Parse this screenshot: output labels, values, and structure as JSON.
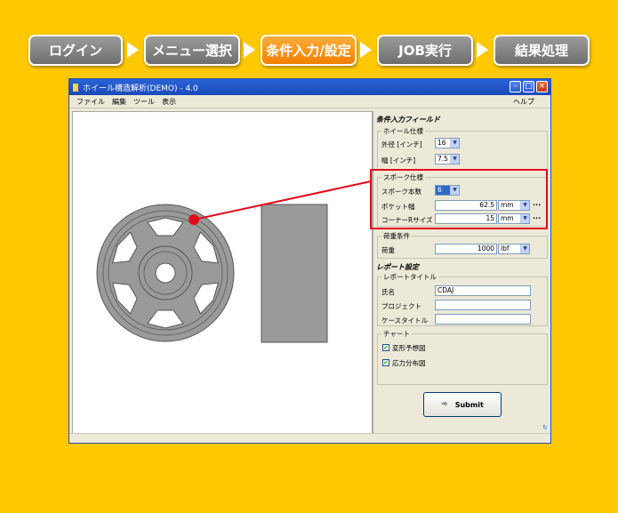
{
  "steps": [
    {
      "label": "ログイン",
      "active": false
    },
    {
      "label": "メニュー選択",
      "active": false
    },
    {
      "label": "条件入力/設定",
      "active": true
    },
    {
      "label": "JOB実行",
      "active": false
    },
    {
      "label": "結果処理",
      "active": false
    }
  ],
  "window": {
    "title": "ホイール構造解析(DEMO) - 4.0",
    "menu": [
      "ファイル",
      "編集",
      "ツール",
      "表示"
    ],
    "help": "ヘルプ"
  },
  "panel": {
    "header": "条件入力フィールド",
    "wheel_spec": {
      "title": "ホイール仕様",
      "diameter_label": "外径 [インチ]",
      "diameter_value": "16",
      "width_label": "幅 [インチ]",
      "width_value": "7.5"
    },
    "spoke_spec": {
      "title": "スポーク仕様",
      "count_label": "スポーク本数",
      "count_value": "6",
      "pocket_label": "ポケット幅",
      "pocket_value": "62.5",
      "pocket_unit": "mm",
      "corner_label": "コーナーRサイズ",
      "corner_value": "15",
      "corner_unit": "mm",
      "more": "..."
    },
    "load": {
      "title": "荷重条件",
      "label": "荷重",
      "value": "1000",
      "unit": "lbf"
    },
    "report": {
      "header": "レポート設定",
      "title_group": "レポートタイトル",
      "name_label": "氏名",
      "name_value": "CDAJ",
      "project_label": "プロジェクト",
      "project_value": "",
      "case_label": "ケースタイトル",
      "case_value": "",
      "chart_group": "チャート",
      "chart_options": [
        {
          "label": "変形予想図",
          "checked": true
        },
        {
          "label": "応力分布図",
          "checked": true
        }
      ]
    },
    "submit_label": "Submit"
  },
  "colors": {
    "background": "#FFC800",
    "active_step": "#F28A10",
    "inactive_step": "#8A8A8A",
    "highlight": "#E3081B"
  }
}
